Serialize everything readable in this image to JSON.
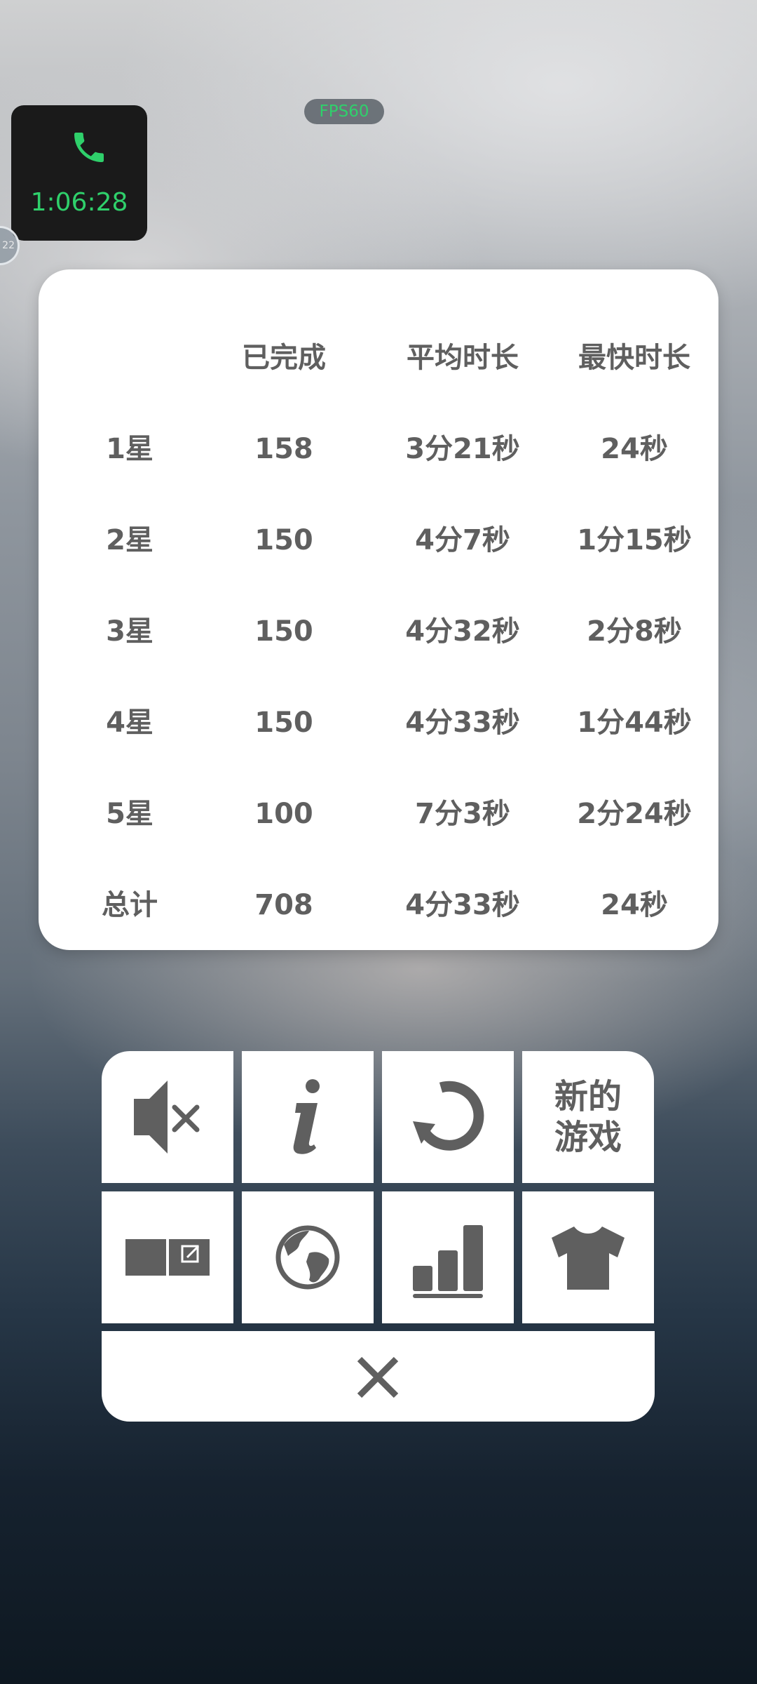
{
  "status": {
    "fps_label": "FPS60",
    "call_time": "1:06:28",
    "bubble_text": "22"
  },
  "stats": {
    "headers": [
      "",
      "已完成",
      "平均时长",
      "最快时长"
    ],
    "rows": [
      {
        "label": "1星",
        "completed": "158",
        "average": "3分21秒",
        "fastest": "24秒"
      },
      {
        "label": "2星",
        "completed": "150",
        "average": "4分7秒",
        "fastest": "1分15秒"
      },
      {
        "label": "3星",
        "completed": "150",
        "average": "4分32秒",
        "fastest": "2分8秒"
      },
      {
        "label": "4星",
        "completed": "150",
        "average": "4分33秒",
        "fastest": "1分44秒"
      },
      {
        "label": "5星",
        "completed": "100",
        "average": "7分3秒",
        "fastest": "2分24秒"
      },
      {
        "label": "总计",
        "completed": "708",
        "average": "4分33秒",
        "fastest": "24秒"
      }
    ]
  },
  "menu": {
    "new_game_line1": "新的",
    "new_game_line2": "游戏",
    "icons": [
      "mute-icon",
      "info-icon",
      "restart-icon",
      "notes-icon",
      "globe-icon",
      "stats-icon",
      "tshirt-icon",
      "close-icon"
    ]
  },
  "colors": {
    "accent_green": "#2fd06b",
    "text_gray": "#5f5f5f",
    "card_white": "#ffffff"
  }
}
